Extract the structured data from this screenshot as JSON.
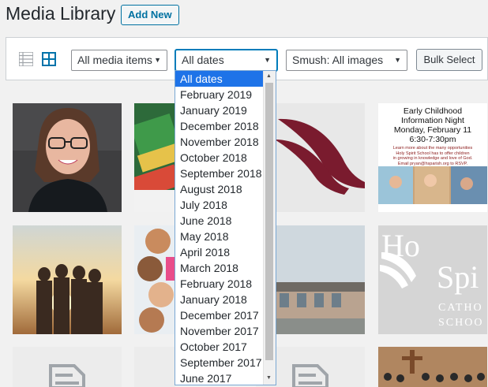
{
  "header": {
    "title": "Media Library",
    "add_new": "Add New"
  },
  "toolbar": {
    "filter_type": "All media items",
    "filter_date": "All dates",
    "filter_smush": "Smush: All images",
    "bulk_select": "Bulk Select"
  },
  "date_options": [
    "All dates",
    "February 2019",
    "January 2019",
    "December 2018",
    "November 2018",
    "October 2018",
    "September 2018",
    "August 2018",
    "July 2018",
    "June 2018",
    "May 2018",
    "April 2018",
    "March 2018",
    "February 2018",
    "January 2018",
    "December 2017",
    "November 2017",
    "October 2017",
    "September 2017",
    "June 2017"
  ],
  "flyer": {
    "line1": "Early Childhood",
    "line2": "Information Night",
    "line3": "Monday, February 11",
    "line4": "6:30-7:30pm",
    "small1": "Learn more about the many opportunities",
    "small2": "Holy Spirit School has to offer children",
    "small3": "in growing in knowledge and love of God.",
    "small4": "Email pryan@hsparish.org to RSVP."
  },
  "logo_text": {
    "l1": "Ho",
    "l2": "Spi",
    "l3": "CATHO",
    "l4": "SCHOO"
  },
  "colors": {
    "accent": "#0071a1",
    "maroon": "#7a1b2e",
    "highlight": "#1e73e8"
  }
}
